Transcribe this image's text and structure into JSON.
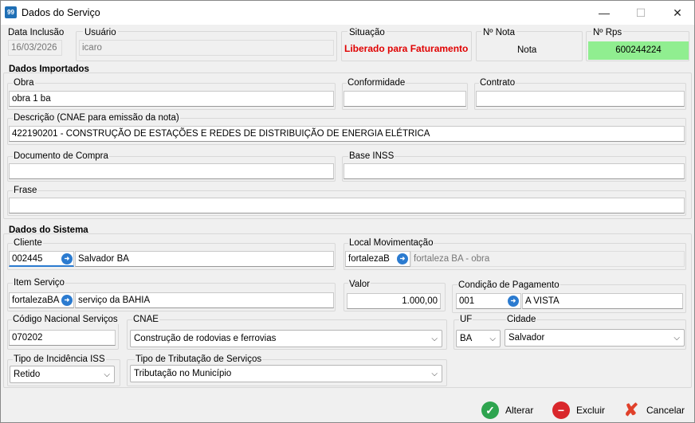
{
  "window": {
    "title": "Dados do Serviço",
    "icon_text": "99"
  },
  "header": {
    "data_inclusao_label": "Data Inclusão",
    "data_inclusao": "16/03/2026",
    "usuario_label": "Usuário",
    "usuario": "icaro",
    "situacao_label": "Situação",
    "situacao": "Liberado para Faturamento",
    "situacao_color": "#e00000",
    "nota_label": "Nº Nota",
    "nota": "Nota",
    "rps_label": "Nº Rps",
    "rps": "600244224",
    "rps_bg": "#90ee90"
  },
  "importados": {
    "section": "Dados Importados",
    "obra_label": "Obra",
    "obra": "obra 1 ba",
    "conformidade_label": "Conformidade",
    "conformidade": "",
    "contrato_label": "Contrato",
    "contrato": "",
    "descricao_label": "Descrição (CNAE para emissão da nota)",
    "descricao": "422190201 - CONSTRUÇÃO DE ESTAÇÕES E REDES DE DISTRIBUIÇÃO DE ENERGIA ELÉTRICA",
    "documento_label": "Documento de Compra",
    "documento": "",
    "inss_label": "Base INSS",
    "inss": "",
    "frase_label": "Frase",
    "frase": ""
  },
  "sistema": {
    "section": "Dados do Sistema",
    "cliente_label": "Cliente",
    "cliente_code": "002445",
    "cliente_name": "Salvador BA",
    "local_label": "Local Movimentação",
    "local_code": "fortalezaB",
    "local_name": "fortaleza BA - obra",
    "item_label": "Item Serviço",
    "item_code": "fortalezaBA",
    "item_name": "serviço da BAHIA",
    "valor_label": "Valor",
    "valor": "1.000,00",
    "condicao_label": "Condição de Pagamento",
    "condicao_code": "001",
    "condicao_name": "A VISTA",
    "codnac_label": "Código Nacional Serviços",
    "codnac": "070202",
    "cnae_label": "CNAE",
    "cnae": "Construção de rodovias e ferrovias",
    "uf_label": "UF",
    "uf": "BA",
    "cidade_label": "Cidade",
    "cidade": "Salvador",
    "incidencia_label": "Tipo de Incidência ISS",
    "incidencia": "Retido",
    "tributacao_label": "Tipo de Tributação de Serviços",
    "tributacao": "Tributação no Município"
  },
  "actions": {
    "alterar": "Alterar",
    "excluir": "Excluir",
    "cancelar": "Cancelar"
  }
}
